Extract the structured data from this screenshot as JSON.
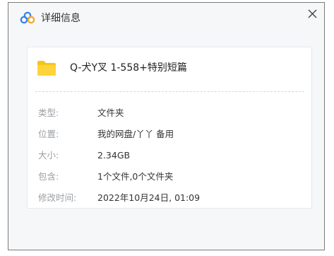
{
  "window": {
    "title": "详细信息",
    "app_icon": "baidu-netdisk-cloud-icon",
    "close_icon": "close-icon",
    "accent_blue": "#2f80ed",
    "accent_orange": "#f5a623"
  },
  "file": {
    "icon": "folder-icon",
    "folder_color": "#f5c518",
    "name": "Q-犬Y叉 1-558+特别短篇"
  },
  "details": [
    {
      "label": "类型:",
      "value": "文件夹"
    },
    {
      "label": "位置:",
      "value": "我的网盘/丫丫 备用"
    },
    {
      "label": "大小:",
      "value": "2.34GB"
    },
    {
      "label": "包含:",
      "value": "1个文件,0个文件夹"
    },
    {
      "label": "修改时间:",
      "value": "2022年10月24日, 01:09"
    }
  ]
}
